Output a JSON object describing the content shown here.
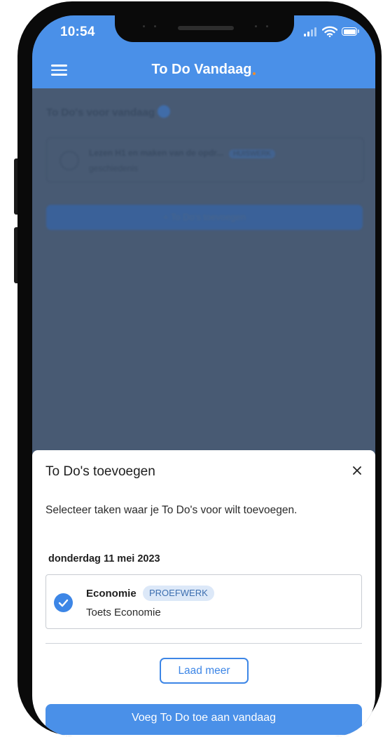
{
  "status_bar": {
    "time": "10:54"
  },
  "header": {
    "title": "To Do Vandaag"
  },
  "background": {
    "heading": "To Do's voor vandaag",
    "task_title": "Lezen H1 en maken van de opdr...",
    "task_chip": "HUISWERK",
    "task_subject": "geschiedenis",
    "add_button": "+ To Do's toevoegen"
  },
  "sheet": {
    "title": "To Do's toevoegen",
    "description": "Selecteer taken waar je To Do's voor wilt toevoegen.",
    "date": "donderdag 11 mei 2023",
    "task": {
      "subject": "Economie",
      "type": "PROEFWERK",
      "description": "Toets Economie",
      "selected": true
    },
    "load_more": "Laad meer",
    "primary_button": "Voeg To Do toe aan vandaag"
  },
  "colors": {
    "primary": "#4a90e8",
    "overlay": "#485a73",
    "chip_bg": "#dce8f8",
    "accent_dot": "#f28c28"
  },
  "icons": [
    "menu-icon",
    "close-icon",
    "check-icon",
    "help-icon",
    "signal-icon",
    "wifi-icon",
    "battery-icon"
  ]
}
